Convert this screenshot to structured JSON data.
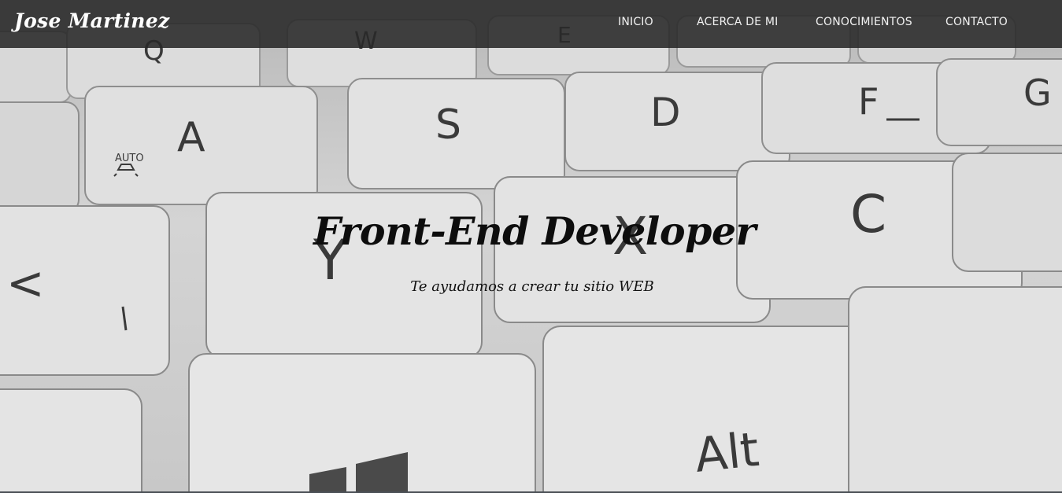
{
  "brand": {
    "name": "Jose Martinez"
  },
  "nav": {
    "items": [
      {
        "label": "INICIO"
      },
      {
        "label": "ACERCA DE MI"
      },
      {
        "label": "CONOCIMIENTOS"
      },
      {
        "label": "CONTACTO"
      }
    ]
  },
  "hero": {
    "title": "Front-End Developer",
    "subtitle": "Te ayudamos a crear tu sitio WEB",
    "background_keys": {
      "k_q": "Q",
      "k_w": "W",
      "k_e": "E",
      "k_a": "A",
      "k_auto": "AUTO",
      "k_s": "S",
      "k_d": "D",
      "k_f": "F",
      "k_g": "G",
      "k_lt": "<",
      "k_y": "Y",
      "k_x": "X",
      "k_c": "C",
      "k_alt": "Alt"
    }
  },
  "colors": {
    "navbar_bg": "#282828",
    "nav_text": "#f2f2f2",
    "hero_text": "#0d0d0d"
  }
}
